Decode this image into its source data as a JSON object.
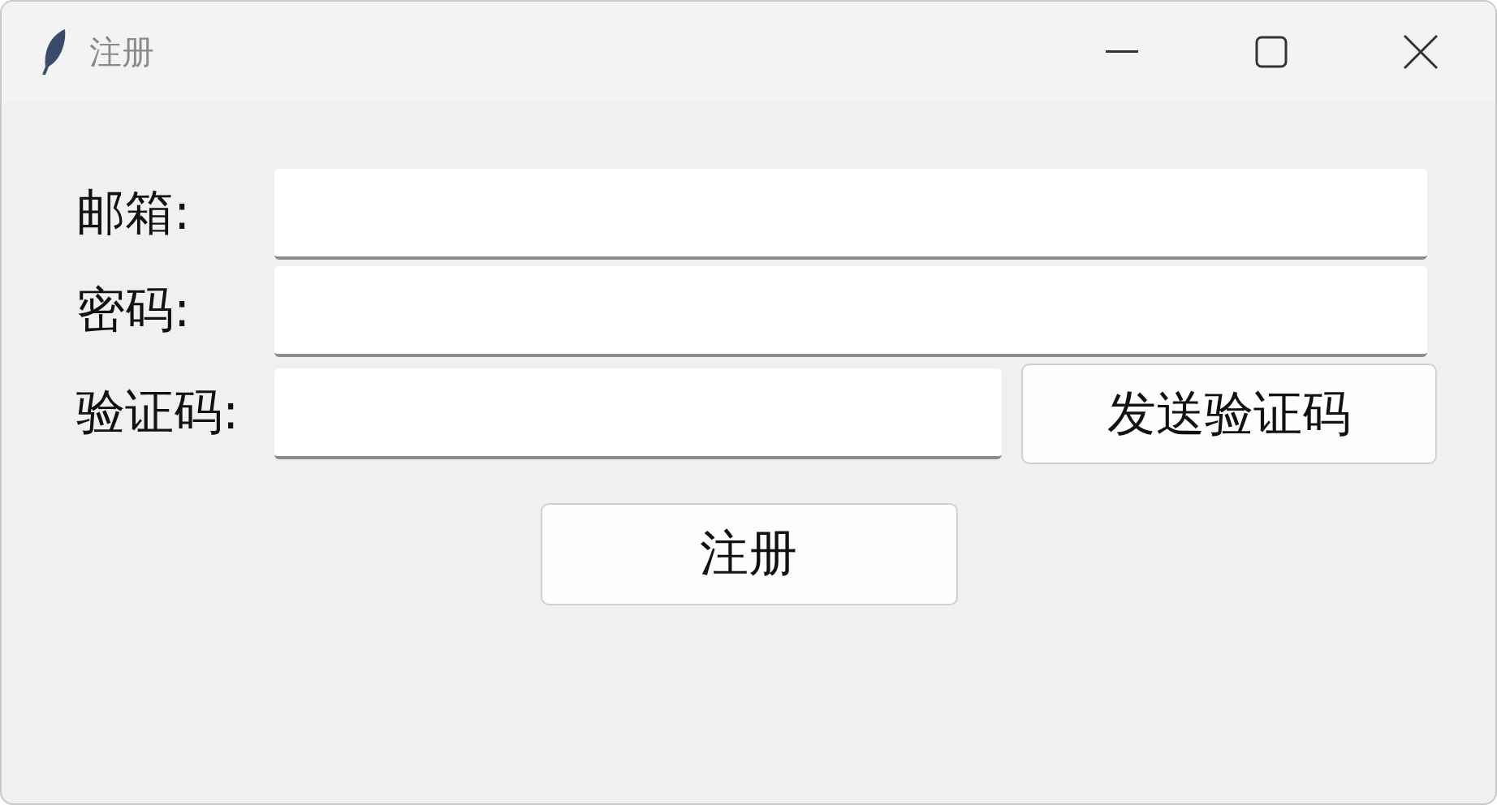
{
  "window": {
    "title": "注册"
  },
  "fields": [
    {
      "label": "邮箱:"
    },
    {
      "label": "密码:"
    },
    {
      "label": "验证码:"
    }
  ],
  "send_button": "发送验证码",
  "submit_button": "注册"
}
